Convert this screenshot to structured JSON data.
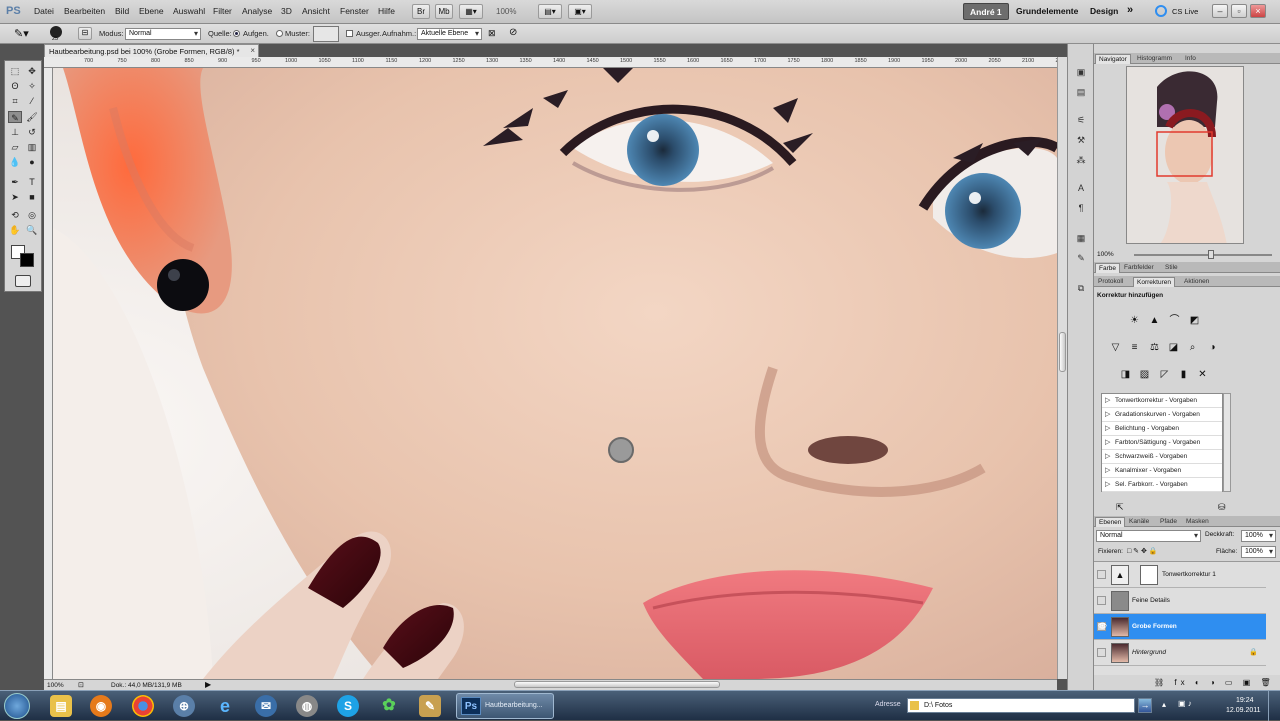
{
  "app": {
    "logo": "PS"
  },
  "menu": [
    "Datei",
    "Bearbeiten",
    "Bild",
    "Ebene",
    "Auswahl",
    "Filter",
    "Analyse",
    "3D",
    "Ansicht",
    "Fenster",
    "Hilfe"
  ],
  "zoom_menu": "100%",
  "workspaces": {
    "active": "André 1",
    "other": [
      "Grundelemente",
      "Design"
    ],
    "more": "»",
    "cslive": "CS Live"
  },
  "options": {
    "mode_label": "Modus:",
    "mode_value": "Normal",
    "source_label": "Quelle:",
    "source_sampled": "Aufgen.",
    "pattern_label": "Muster:",
    "aligned_label": "Ausger.",
    "sample_label": "Aufnahm.:",
    "sample_value": "Aktuelle Ebene",
    "brush_size": "25"
  },
  "document": {
    "tab_title": "Hautbearbeitung.psd bei 100% (Grobe Formen, RGB/8) *",
    "close": "×"
  },
  "ruler_top": [
    "700",
    "750",
    "800",
    "850",
    "900",
    "950",
    "1000",
    "1050",
    "1100",
    "1150",
    "1200",
    "1250",
    "1300",
    "1350",
    "1400",
    "1450",
    "1500",
    "1550",
    "1600",
    "1650",
    "1700",
    "1750",
    "1800",
    "1850",
    "1900",
    "1950",
    "2000",
    "2050",
    "2100",
    "2150",
    "2200"
  ],
  "status": {
    "zoom": "100%",
    "doc": "Dok.: 44,0 MB/131,9 MB"
  },
  "panels": {
    "nav_tabs": [
      "Navigator",
      "Histogramm",
      "Info"
    ],
    "nav_zoom": "100%",
    "color_tabs": [
      "Farbe",
      "Farbfelder",
      "Stile"
    ],
    "adj_tabs": [
      "Protokoll",
      "Korrekturen",
      "Aktionen"
    ],
    "adj_title": "Korrektur hinzufügen",
    "presets": [
      "Tonwertkorrektur - Vorgaben",
      "Gradationskurven - Vorgaben",
      "Belichtung - Vorgaben",
      "Farbton/Sättigung - Vorgaben",
      "Schwarzweiß - Vorgaben",
      "Kanalmixer - Vorgaben",
      "Sel. Farbkorr. - Vorgaben"
    ],
    "layer_tabs": [
      "Ebenen",
      "Kanäle",
      "Pfade",
      "Masken"
    ],
    "blend_mode": "Normal",
    "opacity_label": "Deckkraft:",
    "opacity_value": "100%",
    "lock_label": "Fixieren:",
    "fill_label": "Fläche:",
    "fill_value": "100%",
    "layers": [
      {
        "name": "Tonwertkorrektur 1",
        "selected": false,
        "visible": false
      },
      {
        "name": "Feine Details",
        "selected": false,
        "visible": false
      },
      {
        "name": "Grobe Formen",
        "selected": true,
        "visible": true
      },
      {
        "name": "Hintergrund",
        "selected": false,
        "visible": false
      }
    ]
  },
  "taskbar": {
    "active_task": "Hautbearbeitung...",
    "address_label": "Adresse",
    "address_value": "D:\\ Fotos",
    "time": "19:24",
    "date": "12.09.2011"
  },
  "colors": {
    "selection": "#2f8ef0",
    "skin": "#e9c7b4",
    "lip": "#e36b72",
    "eye": "#3d6f97"
  }
}
